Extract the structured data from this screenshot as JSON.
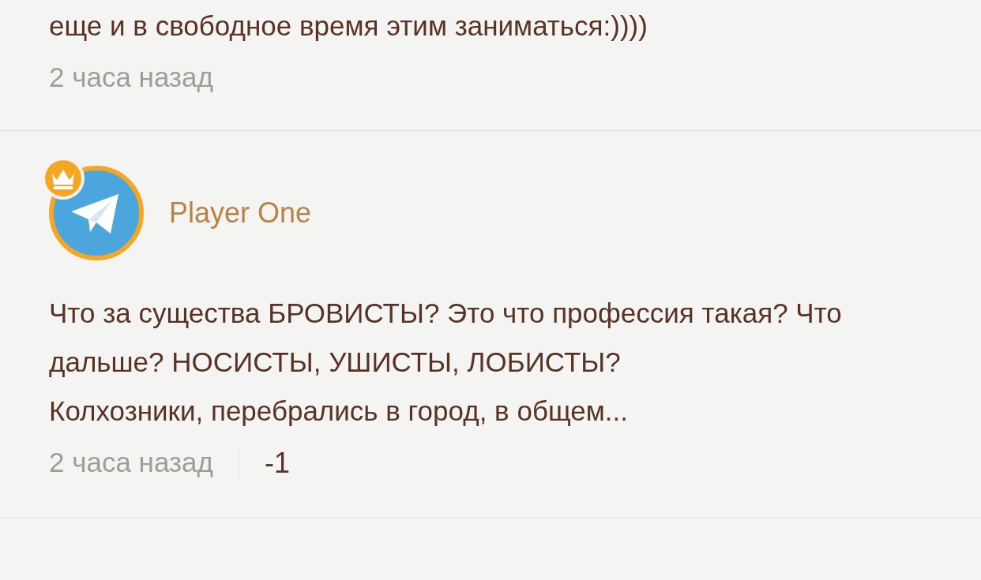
{
  "comments": [
    {
      "text": "еще и в свободное время этим заниматься:))))",
      "time": "2 часа назад"
    },
    {
      "author": "Player One",
      "crowned": true,
      "text": "Что за существа БРОВИСТЫ? Это что профессия такая? Что дальше? НОСИСТЫ, УШИСТЫ, ЛОБИСТЫ?\nКолхозники, перебрались в город, в общем...",
      "time": "2 часа назад",
      "votes": "-1"
    }
  ]
}
